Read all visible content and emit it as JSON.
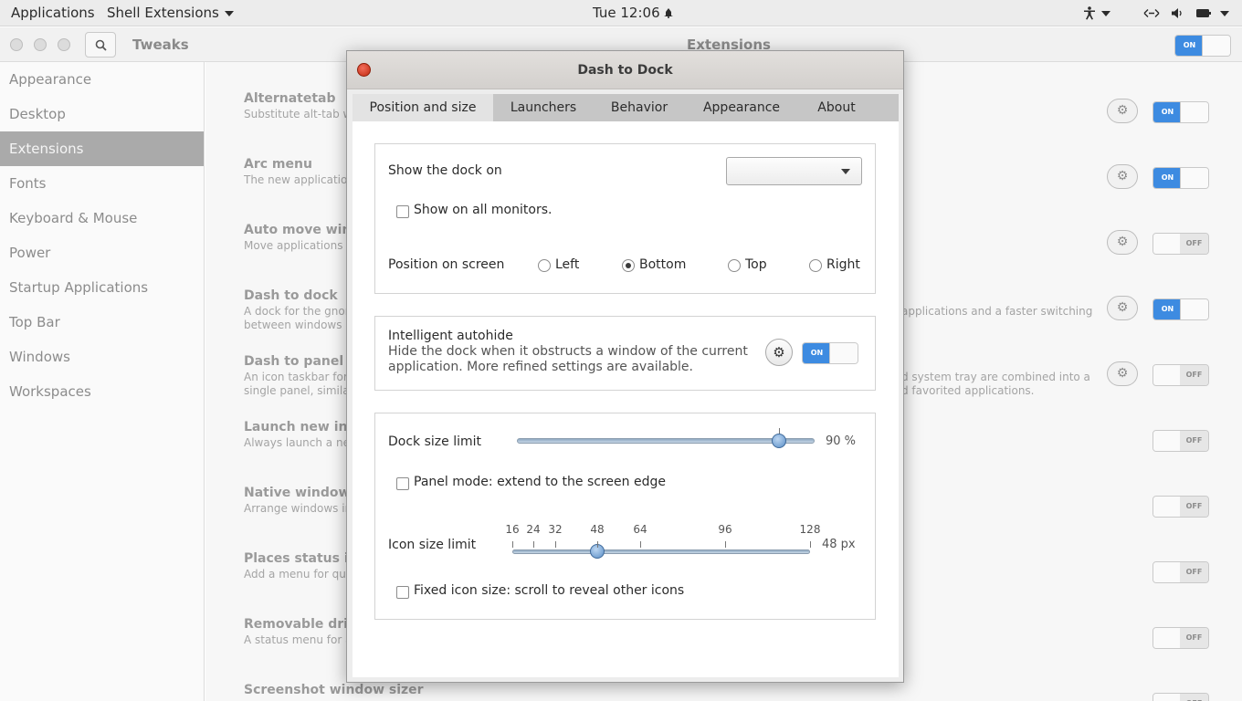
{
  "topbar": {
    "applications": "Applications",
    "shell_extensions": "Shell Extensions",
    "clock": "Tue 12:06",
    "icons": [
      "accessibility-icon",
      "network-icon",
      "volume-icon",
      "battery-icon",
      "power-menu-icon"
    ]
  },
  "tweaks": {
    "title": "Tweaks",
    "panel_title": "Extensions",
    "global_switch": "ON",
    "sidebar": [
      "Appearance",
      "Desktop",
      "Extensions",
      "Fonts",
      "Keyboard & Mouse",
      "Power",
      "Startup Applications",
      "Top Bar",
      "Windows",
      "Workspaces"
    ],
    "active_item": "Extensions",
    "extensions": [
      {
        "name": "Alternatetab",
        "desc": "Substitute alt-tab wi",
        "state": "ON",
        "has_settings": true
      },
      {
        "name": "Arc menu",
        "desc": "The new applications",
        "state": "ON",
        "has_settings": true
      },
      {
        "name": "Auto move wind",
        "desc": "Move applications to",
        "state": "OFF",
        "has_settings": true
      },
      {
        "name": "Dash to dock",
        "desc": "A dock for the gnom",
        "desc2": "between windows an",
        "desc_right": "applications and a faster switching",
        "state": "ON",
        "has_settings": true
      },
      {
        "name": "Dash to panel",
        "desc": "An icon taskbar for t",
        "desc2": "single panel, similar t",
        "desc_right": "d system tray are combined into a",
        "desc_right2": "d favorited applications.",
        "state": "OFF",
        "has_settings": true
      },
      {
        "name": "Launch new inst",
        "desc": "Always launch a new",
        "state": "OFF",
        "has_settings": false
      },
      {
        "name": "Native window p",
        "desc": "Arrange windows in",
        "state": "OFF",
        "has_settings": false
      },
      {
        "name": "Places status ind",
        "desc": "Add a menu for quic",
        "state": "OFF",
        "has_settings": false
      },
      {
        "name": "Removable drive",
        "desc": "A status menu for ac",
        "state": "OFF",
        "has_settings": false
      },
      {
        "name": "Screenshot window sizer",
        "desc": "",
        "state": "OFF",
        "has_settings": false
      }
    ]
  },
  "dialog": {
    "title": "Dash to Dock",
    "tabs": [
      "Position and size",
      "Launchers",
      "Behavior",
      "Appearance",
      "About"
    ],
    "active_tab": "Position and size",
    "show_dock_on_label": "Show the dock on",
    "show_dock_on_value": "",
    "show_all_monitors_label": "Show on all monitors.",
    "show_all_monitors_checked": false,
    "position_label": "Position on screen",
    "positions": [
      "Left",
      "Bottom",
      "Top",
      "Right"
    ],
    "position_selected": "Bottom",
    "autohide_title": "Intelligent autohide",
    "autohide_desc1": "Hide the dock when it obstructs a window of the current",
    "autohide_desc2": "application. More refined settings are available.",
    "autohide_state": "ON",
    "dock_size_label": "Dock size limit",
    "dock_size_value": "90 %",
    "dock_size_fraction": 0.9,
    "panel_mode_label": "Panel mode: extend to the screen edge",
    "panel_mode_checked": false,
    "icon_size_label": "Icon size limit",
    "icon_size_value": "48 px",
    "icon_size_marks": [
      "16",
      "24",
      "32",
      "48",
      "64",
      "96",
      "128"
    ],
    "icon_size_selected": 48,
    "fixed_icon_label": "Fixed icon size: scroll to reveal other icons",
    "fixed_icon_checked": false
  }
}
